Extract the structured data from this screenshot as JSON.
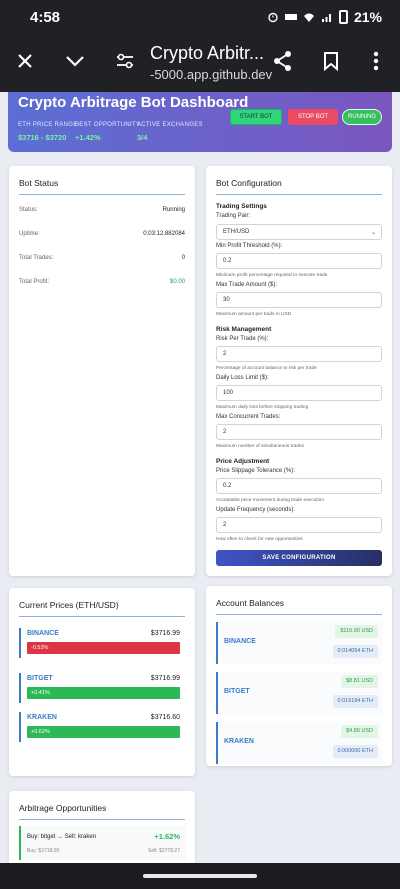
{
  "status_bar": {
    "time": "4:58",
    "battery": "21%"
  },
  "browser": {
    "title": "Crypto Arbitr...",
    "url": "-5000.app.github.dev"
  },
  "header": {
    "title": "Crypto Arbitrage Bot Dashboard",
    "stats": [
      {
        "label": "ETH PRICE RANGE",
        "value": "$3716 - $3720"
      },
      {
        "label": "BEST OPPORTUNITY",
        "value": "+1.42%"
      },
      {
        "label": "ACTIVE EXCHANGES",
        "value": "3/4"
      }
    ],
    "start_label": "START BOT",
    "stop_label": "STOP BOT",
    "running_label": "RUNNING"
  },
  "bot_status": {
    "title": "Bot Status",
    "rows": [
      {
        "label": "Status:",
        "value": "Running"
      },
      {
        "label": "Uptime:",
        "value": "0:03:12.882084"
      },
      {
        "label": "Total Trades:",
        "value": "0"
      },
      {
        "label": "Total Profit:",
        "value": "$0.00"
      }
    ]
  },
  "config": {
    "title": "Bot Configuration",
    "trading_settings": "Trading Settings",
    "trading_pair_label": "Trading Pair:",
    "trading_pair_value": "ETH/USD",
    "min_profit_label": "Min Profit Threshold (%):",
    "min_profit_value": "0.2",
    "min_profit_help": "Minimum profit percentage required to execute trade",
    "max_trade_label": "Max Trade Amount ($):",
    "max_trade_value": "30",
    "max_trade_help": "Maximum amount per trade in USD",
    "risk_management": "Risk Management",
    "risk_per_trade_label": "Risk Per Trade (%):",
    "risk_per_trade_value": "2",
    "risk_per_trade_help": "Percentage of account balance to risk per trade",
    "daily_loss_label": "Daily Loss Limit ($):",
    "daily_loss_value": "100",
    "daily_loss_help": "Maximum daily loss before stopping trading",
    "max_concurrent_label": "Max Concurrent Trades:",
    "max_concurrent_value": "2",
    "max_concurrent_help": "Maximum number of simultaneous trades",
    "price_adjustment": "Price Adjustment",
    "slippage_label": "Price Slippage Tolerance (%):",
    "slippage_value": "0.2",
    "slippage_help": "Acceptable price movement during trade execution",
    "update_freq_label": "Update Frequency (seconds):",
    "update_freq_value": "2",
    "update_freq_help": "How often to check for new opportunities",
    "save_label": "SAVE CONFIGURATION"
  },
  "prices": {
    "title": "Current Prices (ETH/USD)",
    "items": [
      {
        "exchange": "BINANCE",
        "price": "$3716.99",
        "change": "-0.53%",
        "direction": "neg"
      },
      {
        "exchange": "BITGET",
        "price": "$3716.99",
        "change": "+0.41%",
        "direction": "pos"
      },
      {
        "exchange": "KRAKEN",
        "price": "$3716.60",
        "change": "+0.62%",
        "direction": "pos"
      }
    ]
  },
  "balances": {
    "title": "Account Balances",
    "items": [
      {
        "exchange": "BINANCE",
        "usd": "$110.90 USD",
        "eth": "0.014054 ETH"
      },
      {
        "exchange": "BITGET",
        "usd": "$8.81 USD",
        "eth": "0.016184 ETH"
      },
      {
        "exchange": "KRAKEN",
        "usd": "$4.89 USD",
        "eth": "0.000000 ETH"
      }
    ]
  },
  "opportunities": {
    "title": "Arbitrage Opportunities",
    "items": [
      {
        "route": "Buy: bitget → Sell: kraken",
        "pct": "+1.62%",
        "buy": "Buy: $3718.00",
        "sell": "Sell: $3778.27"
      }
    ]
  },
  "colors": {
    "accent": "#3a7bc8",
    "positive": "#2bb855",
    "negative": "#dc3545"
  }
}
